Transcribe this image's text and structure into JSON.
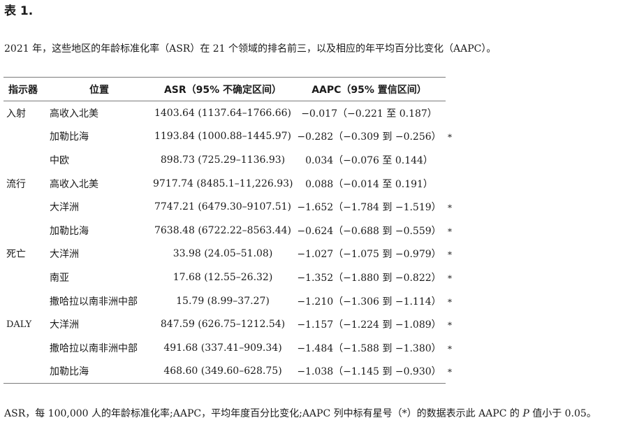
{
  "title": "表 1.",
  "caption": "2021 年，这些地区的年龄标准化率（ASR）在 21 个领域的排名前三，以及相应的年平均百分比变化（AAPC）。",
  "table": {
    "headers": {
      "indicator": "指示器",
      "location": "位置",
      "asr": "ASR（95% 不确定区间）",
      "aapc": "AAPC（95% 置信区间）"
    },
    "rows": [
      {
        "indicator": "入射",
        "location": "高收入北美",
        "asr": "1403.64 (1137.64–1766.66)",
        "aapc": "−0.017（−0.221 至 0.187）",
        "star": ""
      },
      {
        "indicator": "",
        "location": "加勒比海",
        "asr": "1193.84 (1000.88–1445.97)",
        "aapc": "−0.282（−0.309 到 −0.256）",
        "star": "*"
      },
      {
        "indicator": "",
        "location": "中欧",
        "asr": "898.73 (725.29–1136.93)",
        "aapc": "0.034（−0.076 至 0.144）",
        "star": ""
      },
      {
        "indicator": "流行",
        "location": "高收入北美",
        "asr": "9717.74 (8485.1–11,226.93)",
        "aapc": "0.088（−0.014 至 0.191）",
        "star": ""
      },
      {
        "indicator": "",
        "location": "大洋洲",
        "asr": "7747.21 (6479.30–9107.51)",
        "aapc": "−1.652（−1.784 到 −1.519）",
        "star": "*"
      },
      {
        "indicator": "",
        "location": "加勒比海",
        "asr": "7638.48 (6722.22–8563.44)",
        "aapc": "−0.624（−0.688 到 −0.559）",
        "star": "*"
      },
      {
        "indicator": "死亡",
        "location": "大洋洲",
        "asr": "33.98 (24.05–51.08)",
        "aapc": "−1.027（−1.075 到 −0.979）",
        "star": "*"
      },
      {
        "indicator": "",
        "location": "南亚",
        "asr": "17.68 (12.55–26.32)",
        "aapc": "−1.352（−1.880 到 −0.822）",
        "star": "*"
      },
      {
        "indicator": "",
        "location": "撒哈拉以南非洲中部",
        "asr": "15.79 (8.99–37.27)",
        "aapc": "−1.210（−1.306 到 −1.114）",
        "star": "*"
      },
      {
        "indicator": "DALY",
        "location": "大洋洲",
        "asr": "847.59 (626.75–1212.54)",
        "aapc": "−1.157（−1.224 到 −1.089）",
        "star": "*"
      },
      {
        "indicator": "",
        "location": "撒哈拉以南非洲中部",
        "asr": "491.68 (337.41–909.34)",
        "aapc": "−1.484（−1.588 到 −1.380）",
        "star": "*"
      },
      {
        "indicator": "",
        "location": "加勒比海",
        "asr": "468.60 (349.60–628.75)",
        "aapc": "−1.038（−1.145 到 −0.930）",
        "star": "*"
      }
    ]
  },
  "footnote": {
    "before": "ASR，每 100,000 人的年龄标准化率;AAPC，平均年度百分比变化;AAPC 列中标有星号（*）的数据表示此 AAPC 的 ",
    "p": "P",
    "after": " 值小于 0.05。"
  }
}
